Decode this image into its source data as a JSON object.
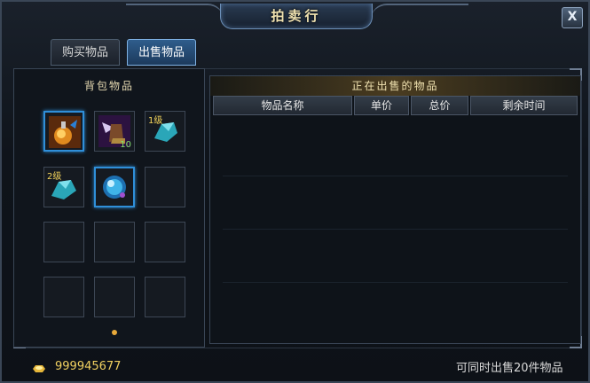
{
  "window": {
    "title": "拍卖行",
    "close_label": "X"
  },
  "tabs": [
    {
      "label": "购买物品",
      "active": false
    },
    {
      "label": "出售物品",
      "active": true
    }
  ],
  "bag": {
    "title": "背包物品",
    "slots": [
      {
        "icon": "potion-flask-icon",
        "selected": true,
        "level": "",
        "count": ""
      },
      {
        "icon": "winged-boots-icon",
        "selected": false,
        "level": "",
        "count": "10"
      },
      {
        "icon": "crystal-ore-icon",
        "selected": false,
        "level": "1级",
        "count": ""
      },
      {
        "icon": "crystal-ore-icon",
        "selected": false,
        "level": "2级",
        "count": ""
      },
      {
        "icon": "crystal-orb-icon",
        "selected": true,
        "level": "",
        "count": ""
      },
      {
        "icon": "",
        "selected": false,
        "level": "",
        "count": ""
      },
      {
        "icon": "",
        "selected": false,
        "level": "",
        "count": ""
      },
      {
        "icon": "",
        "selected": false,
        "level": "",
        "count": ""
      },
      {
        "icon": "",
        "selected": false,
        "level": "",
        "count": ""
      },
      {
        "icon": "",
        "selected": false,
        "level": "",
        "count": ""
      },
      {
        "icon": "",
        "selected": false,
        "level": "",
        "count": ""
      },
      {
        "icon": "",
        "selected": false,
        "level": "",
        "count": ""
      }
    ]
  },
  "on_sale": {
    "title": "正在出售的物品",
    "columns": [
      "物品名称",
      "单价",
      "总价",
      "剩余时间"
    ],
    "rows": []
  },
  "footer": {
    "gold_amount": "999945677",
    "sell_limit_note": "可同时出售20件物品"
  },
  "colors": {
    "accent": "#2f8fd9",
    "gold": "#f0d060",
    "level_text": "#f2d35a"
  }
}
